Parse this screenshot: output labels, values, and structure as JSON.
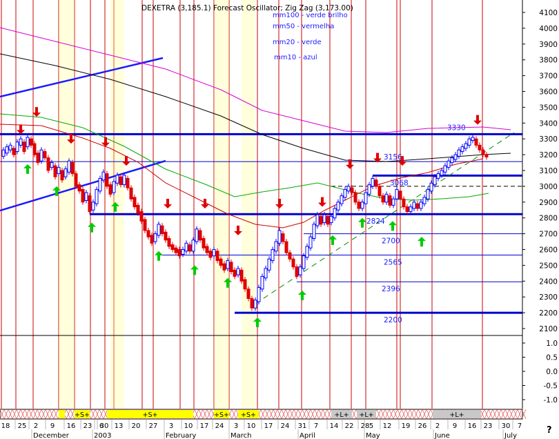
{
  "chart_data": {
    "type": "candlestick",
    "title": "DEXETRA (3,185.1) Forecast Oscillator; Zig Zag (3,173.00)",
    "legend": [
      {
        "label": "mm100 - verde brilho",
        "color": "#1a1aff"
      },
      {
        "label": "mm50 - vermelha",
        "color": "#1a1aff"
      },
      {
        "label": "mm20 - verde",
        "color": "#1a1aff"
      },
      {
        "label": "mm10 - azul",
        "color": "#1a1aff"
      }
    ],
    "price_axis": {
      "min": 2100,
      "max": 4100,
      "step": 100,
      "ticks": [
        "4100",
        "4000",
        "3900",
        "3800",
        "3700",
        "3600",
        "3500",
        "3400",
        "3300",
        "3200",
        "3100",
        "3000",
        "2900",
        "2800",
        "2700",
        "2600",
        "2500",
        "2400",
        "2300",
        "2200",
        "2100"
      ]
    },
    "osc_axis": {
      "ticks": [
        "1.0",
        "0.5",
        "0.0",
        "-0.5",
        "-1.0"
      ]
    },
    "unknown_label": "?",
    "date_ticks": [
      "18",
      "25",
      "2",
      "9",
      "16",
      "23",
      "30",
      "6",
      "13",
      "20",
      "27",
      "3",
      "10",
      "17",
      "24",
      "3",
      "10",
      "17",
      "24",
      "31",
      "7",
      "14",
      "22",
      "28",
      "5",
      "12",
      "19",
      "26",
      "2",
      "9",
      "16",
      "23",
      "30",
      "7"
    ],
    "month_labels": [
      "December",
      "2003",
      "February",
      "March",
      "April",
      "May",
      "June",
      "July"
    ],
    "horizontal_levels": [
      {
        "value": 3330,
        "label": "3330",
        "weight": "thick"
      },
      {
        "value": 3156,
        "label": "3156",
        "weight": "thin"
      },
      {
        "value": 3068,
        "label": "3068",
        "weight": "thick"
      },
      {
        "value": 3000,
        "label": "",
        "weight": "dashed"
      },
      {
        "value": 2824,
        "label": "2824",
        "weight": "thick"
      },
      {
        "value": 2700,
        "label": "2700",
        "weight": "thin"
      },
      {
        "value": 2565,
        "label": "2565",
        "weight": "thin"
      },
      {
        "value": 2396,
        "label": "2396",
        "weight": "thin"
      },
      {
        "value": 2200,
        "label": "2200",
        "weight": "thick"
      }
    ],
    "signals": [
      {
        "label": "+S+"
      },
      {
        "label": "+S+"
      },
      {
        "label": "+S+"
      },
      {
        "label": "+S+"
      },
      {
        "label": "+L+"
      },
      {
        "label": "+L+"
      },
      {
        "label": "+L+"
      }
    ],
    "moving_averages": [
      {
        "name": "mm100",
        "color": "#000000"
      },
      {
        "name": "mm50",
        "color": "#d400d4"
      },
      {
        "name": "mm20",
        "color": "#00aa00"
      },
      {
        "name": "mm10",
        "color": "#cc0000"
      }
    ],
    "colors": {
      "up": "#0000ff",
      "down": "#e00000",
      "sell_arrow": "#e00000",
      "buy_arrow": "#00cc00",
      "vertical_line": "#cc0000",
      "level_line": "#0000cc",
      "signal_bar": "#ffff00"
    }
  }
}
